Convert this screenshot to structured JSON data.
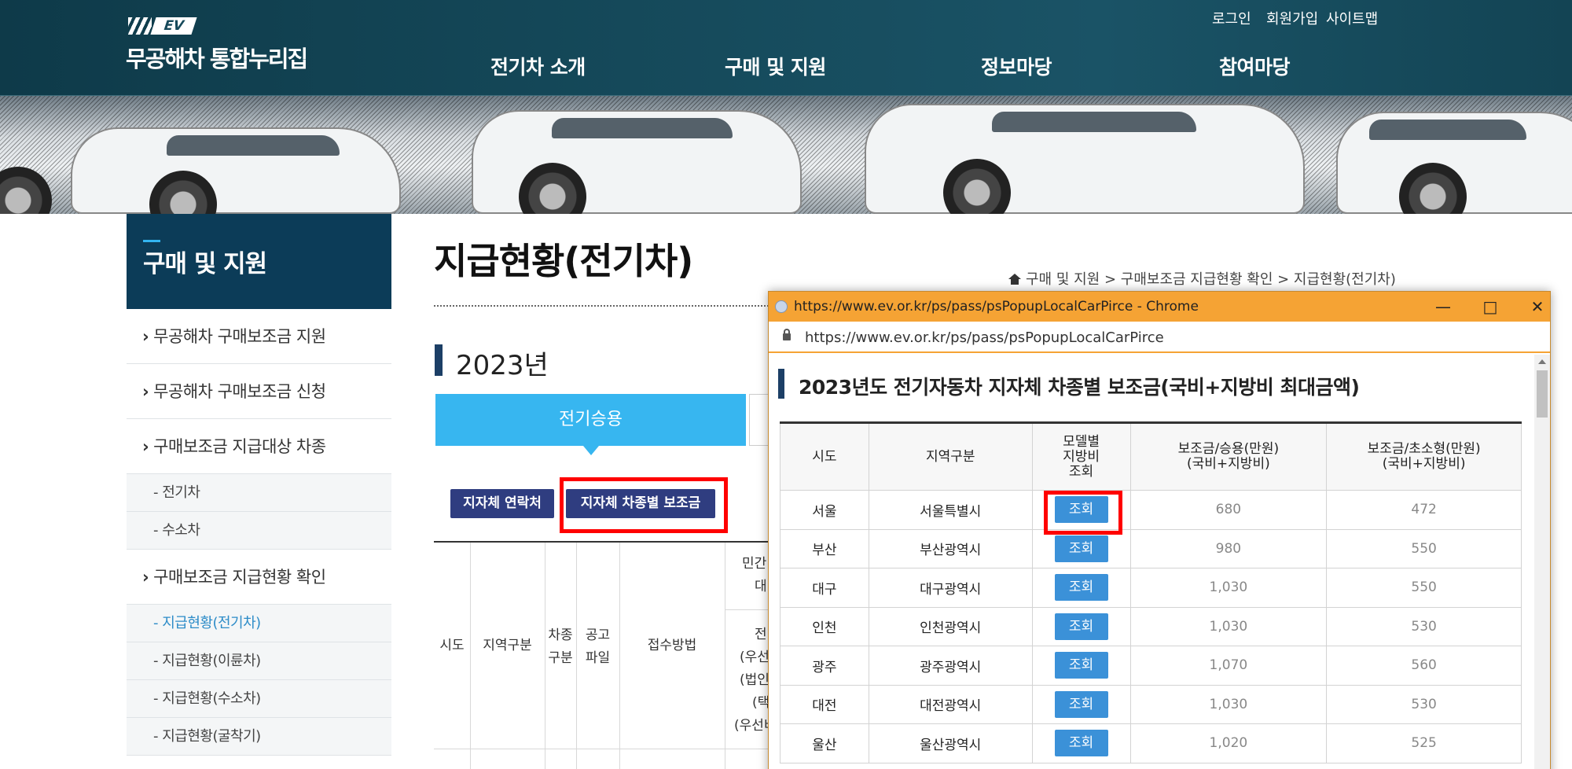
{
  "header": {
    "logo_badge": "EV",
    "logo_text": "무공해차 통합누리집",
    "util": [
      "로그인",
      "회원가입",
      "사이트맵"
    ],
    "nav": [
      "전기차 소개",
      "구매 및 지원",
      "정보마당",
      "참여마당"
    ]
  },
  "sidebar": {
    "title": "구매 및 지원",
    "items": [
      {
        "label": "무공해차 구매보조금 지원",
        "type": "main"
      },
      {
        "label": "무공해차 구매보조금 신청",
        "type": "main"
      },
      {
        "label": "구매보조금 지급대상 차종",
        "type": "main"
      },
      {
        "label": "- 전기차",
        "type": "sub"
      },
      {
        "label": "- 수소차",
        "type": "sub"
      },
      {
        "label": "구매보조금 지급현황 확인",
        "type": "main"
      },
      {
        "label": "- 지급현황(전기차)",
        "type": "sub",
        "active": true
      },
      {
        "label": "- 지급현황(이륜차)",
        "type": "sub"
      },
      {
        "label": "- 지급현황(수소차)",
        "type": "sub"
      },
      {
        "label": "- 지급현황(굴착기)",
        "type": "sub"
      }
    ]
  },
  "content": {
    "title": "지급현황(전기차)",
    "breadcrumb": [
      "구매 및 지원",
      "구매보조금 지급현황 확인",
      "지급현황(전기차)"
    ],
    "year": "2023년",
    "tab_active": "전기승용",
    "buttons": {
      "contact": "지자체 연락처",
      "subsidy": "지자체 차종별 보조금"
    },
    "bg_table": {
      "sido": "시도",
      "region": "지역구분",
      "type_l1": "차종",
      "type_l2": "구분",
      "file_l1": "공고",
      "file_l2": "파일",
      "method": "접수방법",
      "private_top_l1": "민간",
      "private_top_l2": "대",
      "sub_l1": "전",
      "sub_l2": "(우선",
      "sub_l3": "(법인",
      "sub_l4": "(택",
      "sub_l5": "(우선비"
    }
  },
  "popup": {
    "title_bar": "https://www.ev.or.kr/ps/pass/psPopupLocalCarPirce - Chrome",
    "url": "https://www.ev.or.kr/ps/pass/psPopupLocalCarPirce",
    "heading": "2023년도 전기자동차 지자체 차종별 보조금(국비+지방비 최대금액)",
    "columns": {
      "sido": "시도",
      "region": "지역구분",
      "model_l1": "모델별",
      "model_l2": "지방비",
      "model_l3": "조회",
      "sedan_l1": "보조금/승용(만원)",
      "sedan_l2": "(국비+지방비)",
      "small_l1": "보조금/초소형(만원)",
      "small_l2": "(국비+지방비)"
    },
    "query_label": "조회",
    "rows": [
      {
        "sido": "서울",
        "region": "서울특별시",
        "sedan": "680",
        "small": "472"
      },
      {
        "sido": "부산",
        "region": "부산광역시",
        "sedan": "980",
        "small": "550"
      },
      {
        "sido": "대구",
        "region": "대구광역시",
        "sedan": "1,030",
        "small": "550"
      },
      {
        "sido": "인천",
        "region": "인천광역시",
        "sedan": "1,030",
        "small": "530"
      },
      {
        "sido": "광주",
        "region": "광주광역시",
        "sedan": "1,070",
        "small": "560"
      },
      {
        "sido": "대전",
        "region": "대전광역시",
        "sedan": "1,030",
        "small": "530"
      },
      {
        "sido": "울산",
        "region": "울산광역시",
        "sedan": "1,020",
        "small": "525"
      }
    ]
  }
}
